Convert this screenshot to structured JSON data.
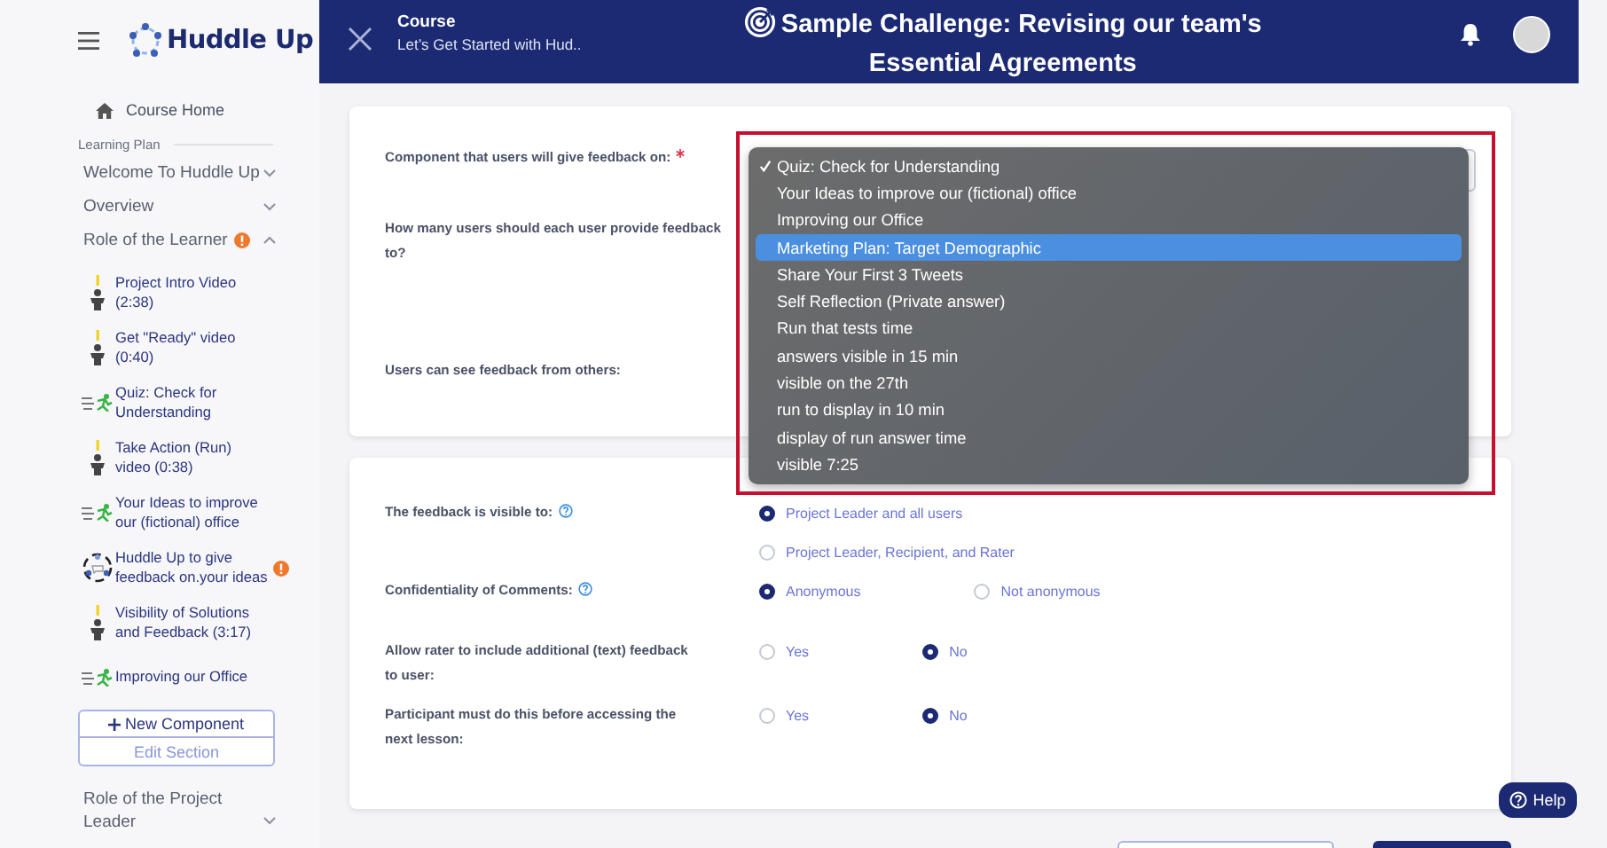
{
  "sidebar": {
    "logo": "Huddle Up",
    "home": "Course Home",
    "plan_label": "Learning Plan",
    "sections": [
      {
        "title": "Welcome To Huddle Up",
        "expanded": false,
        "alert": false
      },
      {
        "title": "Overview",
        "expanded": false,
        "alert": false
      },
      {
        "title": "Role of the Learner",
        "expanded": true,
        "alert": true,
        "children": [
          {
            "kind": "video",
            "title": "Project Intro Video (2:38)",
            "alert": false
          },
          {
            "kind": "video",
            "title": "Get \"Ready\" video (0:40)",
            "alert": false
          },
          {
            "kind": "quiz",
            "title": "Quiz: Check for Understanding",
            "alert": false
          },
          {
            "kind": "video",
            "title": "Take Action (Run) video (0:38)",
            "alert": false
          },
          {
            "kind": "quiz",
            "title": "Your Ideas to improve our (fictional) office",
            "alert": false
          },
          {
            "kind": "huddle",
            "title": "Huddle Up to give feedback on.your ideas",
            "alert": true
          },
          {
            "kind": "video",
            "title": "Visibility of Solutions and Feedback (3:17)",
            "alert": false
          },
          {
            "kind": "quiz",
            "title": "Improving our Office",
            "alert": false
          }
        ],
        "actions": [
          "New Component",
          "Edit Section"
        ]
      },
      {
        "title": "Role of the Project Leader",
        "expanded": false,
        "alert": false
      }
    ]
  },
  "header": {
    "course_label": "Course",
    "course_name": "Let’s Get Started with Hud..",
    "title": "Sample Challenge: Revising our team's Essential Agreements"
  },
  "settings_card": {
    "fields": [
      {
        "label": "Component that users will give feedback on:",
        "required": true
      },
      {
        "label": "How many users should each user provide feedback to?",
        "required": false
      },
      {
        "label": "Users can see feedback from others:",
        "required": false
      }
    ]
  },
  "component_dropdown": {
    "options": [
      {
        "label": "Quiz: Check for Understanding",
        "checked": true,
        "highlighted": false
      },
      {
        "label": "Your Ideas to improve our (fictional) office",
        "checked": false,
        "highlighted": false
      },
      {
        "label": "Improving our Office",
        "checked": false,
        "highlighted": false
      },
      {
        "label": "Marketing Plan: Target Demographic",
        "checked": false,
        "highlighted": true
      },
      {
        "label": "Share Your First 3 Tweets",
        "checked": false,
        "highlighted": false
      },
      {
        "label": "Self Reflection (Private answer)",
        "checked": false,
        "highlighted": false
      },
      {
        "label": "Run that tests time",
        "checked": false,
        "highlighted": false
      },
      {
        "label": "answers visible in 15 min",
        "checked": false,
        "highlighted": false
      },
      {
        "label": "visible on the 27th",
        "checked": false,
        "highlighted": false
      },
      {
        "label": "run to display in 10 min",
        "checked": false,
        "highlighted": false
      },
      {
        "label": "display of run answer time",
        "checked": false,
        "highlighted": false
      },
      {
        "label": "visible 7:25",
        "checked": false,
        "highlighted": false
      }
    ]
  },
  "visibility_card": {
    "fields": [
      {
        "label": "The feedback is visible to:",
        "help": true,
        "kind": "stacked",
        "options": [
          {
            "label": "Project Leader and all users",
            "selected": true
          },
          {
            "label": "Project Leader, Recipient, and Rater",
            "selected": false
          }
        ]
      },
      {
        "label": "Confidentiality of Comments:",
        "help": true,
        "kind": "inline",
        "options": [
          {
            "label": "Anonymous",
            "selected": true
          },
          {
            "label": "Not anonymous",
            "selected": false
          }
        ]
      },
      {
        "label": "Allow rater to include additional (text) feedback to user:",
        "help": false,
        "kind": "inline",
        "options": [
          {
            "label": "Yes",
            "selected": false
          },
          {
            "label": "No",
            "selected": true
          }
        ]
      },
      {
        "label": "Participant must do this before accessing the next lesson:",
        "help": false,
        "kind": "inline",
        "options": [
          {
            "label": "Yes",
            "selected": false
          },
          {
            "label": "No",
            "selected": true
          }
        ]
      }
    ]
  },
  "help_button": "Help"
}
